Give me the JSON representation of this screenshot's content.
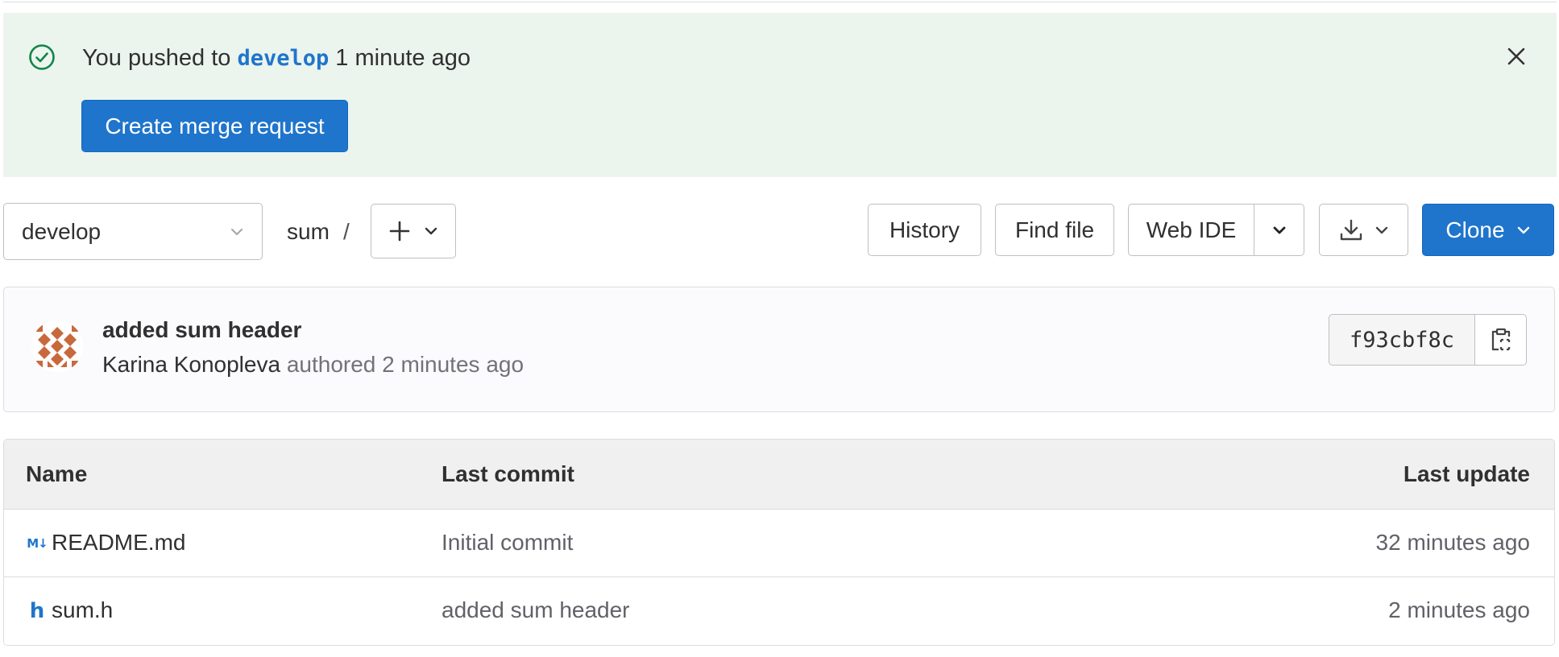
{
  "banner": {
    "message_prefix": "You pushed to ",
    "branch": "develop",
    "message_suffix": " 1 minute ago",
    "create_mr_label": "Create merge request"
  },
  "toolbar": {
    "branch_selected": "develop",
    "path_root": "sum",
    "path_separator": "/",
    "history_label": "History",
    "find_file_label": "Find file",
    "web_ide_label": "Web IDE",
    "clone_label": "Clone"
  },
  "last_commit": {
    "title": "added sum header",
    "author": "Karina Konopleva",
    "meta": " authored 2 minutes ago",
    "sha": "f93cbf8c"
  },
  "file_table": {
    "headers": {
      "name": "Name",
      "last_commit": "Last commit",
      "last_update": "Last update"
    },
    "rows": [
      {
        "icon": "markdown-icon",
        "name": "README.md",
        "last_commit": "Initial commit",
        "last_update": "32 minutes ago"
      },
      {
        "icon": "header-file-icon",
        "name": "sum.h",
        "last_commit": "added sum header",
        "last_update": "2 minutes ago"
      }
    ]
  },
  "colors": {
    "primary": "#1f75cb",
    "success": "#108548",
    "banner_bg": "#ecf4ee",
    "avatar": "#c8693d"
  }
}
